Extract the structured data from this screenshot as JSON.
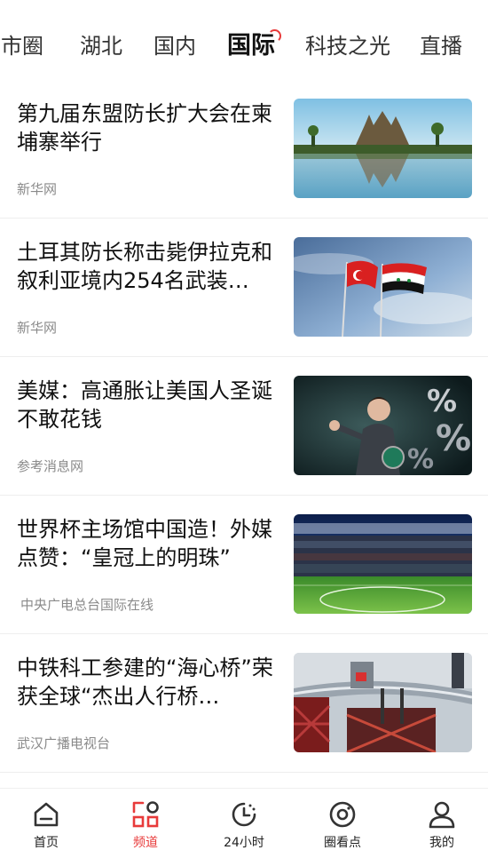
{
  "tabs": [
    {
      "label": "郡市圈",
      "visible_label": "郎市圈"
    },
    {
      "label": "湖北"
    },
    {
      "label": "国内"
    },
    {
      "label": "国际"
    },
    {
      "label": "科技之光"
    },
    {
      "label": "直播"
    }
  ],
  "active_tab": "国际",
  "accent_color": "#e83a3a",
  "feed": [
    {
      "title": "第九届东盟防长扩大会在柬埔寨举行",
      "source": "新华网",
      "image": "temple-reflection"
    },
    {
      "title": "土耳其防长称击毙伊拉克和叙利亚境内254名武装…",
      "source": "新华网",
      "image": "flags-turkey-syria"
    },
    {
      "title": "美媒：高通胀让美国人圣诞不敢花钱",
      "source": "参考消息网",
      "image": "businesswoman-percent"
    },
    {
      "title": "世界杯主场馆中国造！外媒点赞：“皇冠上的明珠”",
      "source": "中央广电总台国际在线",
      "image": "stadium"
    },
    {
      "title": "中铁科工参建的“海心桥”荣获全球“杰出人行桥…",
      "source": "武汉广播电视台",
      "image": "bridge-construction"
    }
  ],
  "bottom_nav": [
    {
      "label": "首页",
      "icon": "home-icon"
    },
    {
      "label": "频道",
      "icon": "channel-grid-icon",
      "active": true
    },
    {
      "label": "24小时",
      "icon": "clock-icon"
    },
    {
      "label": "圈看点",
      "icon": "camera-circle-icon"
    },
    {
      "label": "我的",
      "icon": "user-icon"
    }
  ]
}
